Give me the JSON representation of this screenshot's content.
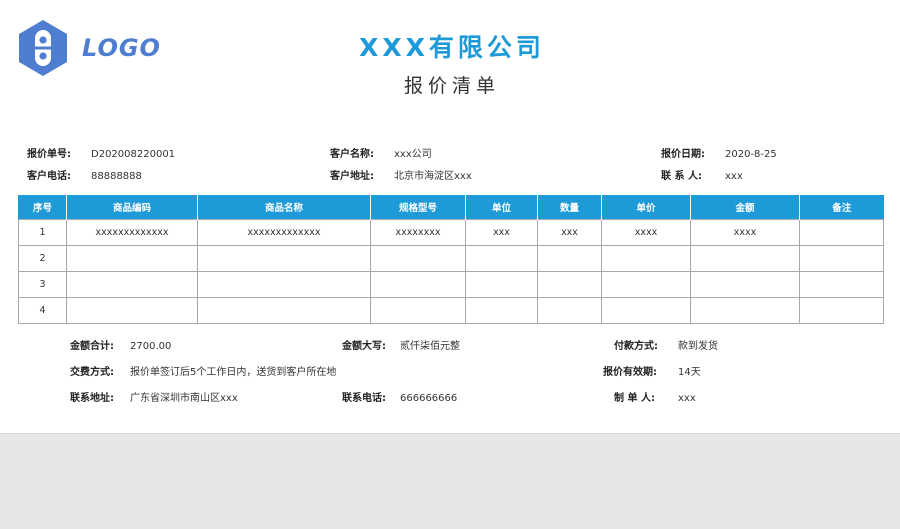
{
  "brand": {
    "logo_text": "LOGO",
    "accent_color": "#1e9ad8",
    "logo_color": "#4f7ed0"
  },
  "header": {
    "company": "XXX有限公司",
    "title": "报价清单"
  },
  "info": {
    "quote_no_label": "报价单号:",
    "quote_no": "D202008220001",
    "client_name_label": "客户名称:",
    "client_name": "xxx公司",
    "quote_date_label": "报价日期:",
    "quote_date": "2020-8-25",
    "client_phone_label": "客户电话:",
    "client_phone": "88888888",
    "client_address_label": "客户地址:",
    "client_address": "北京市海淀区xxx",
    "contact_label": "联 系 人:",
    "contact": "xxx"
  },
  "table": {
    "headers": [
      "序号",
      "商品编码",
      "商品名称",
      "规格型号",
      "单位",
      "数量",
      "单价",
      "金额",
      "备注"
    ],
    "rows": [
      [
        "1",
        "xxxxxxxxxxxxx",
        "xxxxxxxxxxxxx",
        "xxxxxxxx",
        "xxx",
        "xxx",
        "xxxx",
        "xxxx",
        ""
      ],
      [
        "2",
        "",
        "",
        "",
        "",
        "",
        "",
        "",
        ""
      ],
      [
        "3",
        "",
        "",
        "",
        "",
        "",
        "",
        "",
        ""
      ],
      [
        "4",
        "",
        "",
        "",
        "",
        "",
        "",
        "",
        ""
      ]
    ]
  },
  "summary": {
    "total_label": "金额合计:",
    "total": "2700.00",
    "upper_label": "金额大写:",
    "upper": "贰仟柒佰元整",
    "payment_label": "付款方式:",
    "payment": "款到发货",
    "delivery_label": "交费方式:",
    "delivery": "报价单签订后5个工作日内，送货到客户所在地",
    "validity_label": "报价有效期:",
    "validity": "14天",
    "address_label": "联系地址:",
    "address": "广东省深圳市南山区xxx",
    "phone_label": "联系电话:",
    "phone": "666666666",
    "maker_label": "制 单 人:",
    "maker": "xxx"
  }
}
